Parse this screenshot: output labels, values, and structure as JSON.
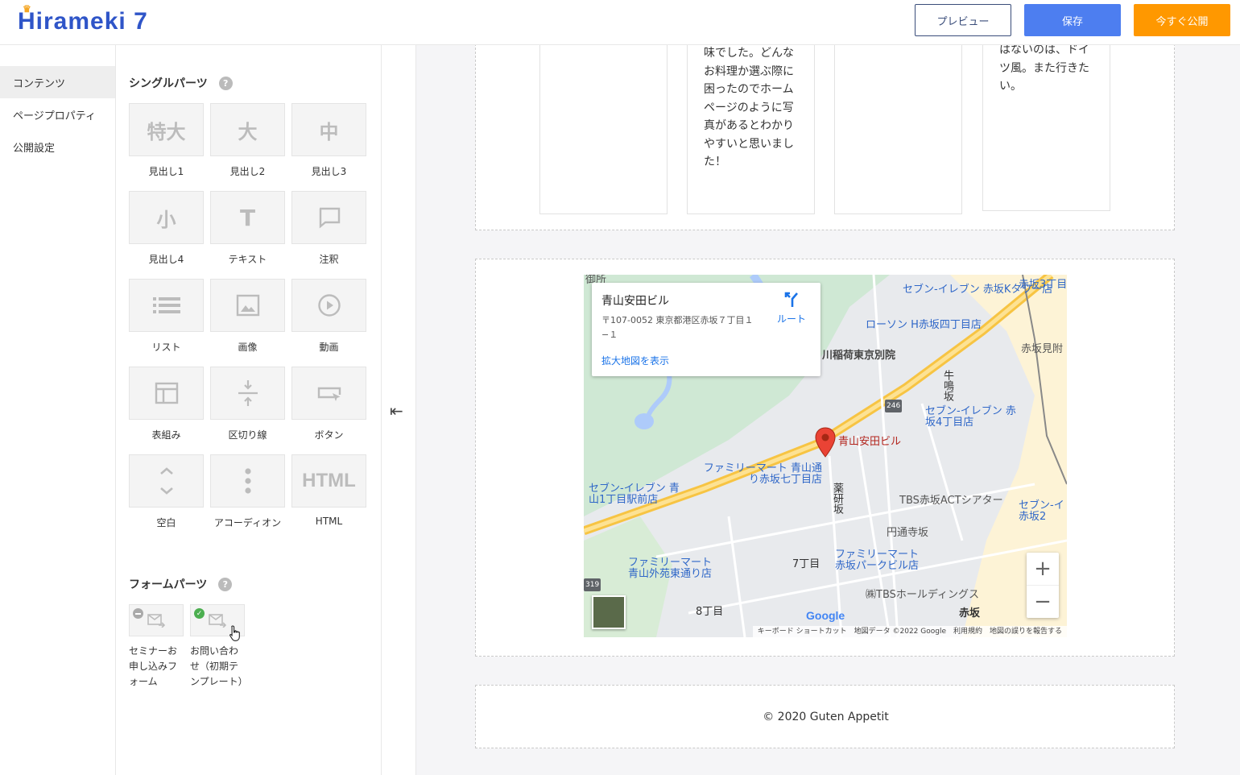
{
  "header": {
    "logo": "Hirameki 7",
    "preview": "プレビュー",
    "save": "保存",
    "publish": "今すぐ公開"
  },
  "nav": {
    "items": [
      "コンテンツ",
      "ページプロパティ",
      "公開設定"
    ]
  },
  "palette": {
    "single_title": "シングルパーツ",
    "help": "?",
    "tiles": [
      {
        "icon": "特大",
        "label": "見出し1"
      },
      {
        "icon": "大",
        "label": "見出し2"
      },
      {
        "icon": "中",
        "label": "見出し3"
      },
      {
        "icon": "小",
        "label": "見出し4"
      },
      {
        "icon": "T",
        "label": "テキスト"
      },
      {
        "icon": "",
        "label": "注釈"
      },
      {
        "icon": "",
        "label": "リスト"
      },
      {
        "icon": "",
        "label": "画像"
      },
      {
        "icon": "",
        "label": "動画"
      },
      {
        "icon": "",
        "label": "表組み"
      },
      {
        "icon": "",
        "label": "区切り線"
      },
      {
        "icon": "",
        "label": "ボタン"
      },
      {
        "icon": "",
        "label": "空白"
      },
      {
        "icon": "",
        "label": "アコーディオン"
      },
      {
        "icon": "HTML",
        "label": "HTML"
      }
    ],
    "form_title": "フォームパーツ",
    "forms": [
      {
        "label": "セミナーお申し込みフォーム"
      },
      {
        "label": "お問い合わせ（初期テンプレート）"
      }
    ]
  },
  "canvas": {
    "cards": [
      "",
      "味でした。どんなお料理か選ぶ際に困ったのでホームページのように写真があるとわかりやすいと思いました！",
      "",
      "はないのは、ドイツ風。また行きたい。"
    ],
    "map": {
      "place_name": "青山安田ビル",
      "address": "〒107-0052 東京都港区赤坂７丁目１−１",
      "route": "ルート",
      "larger_map": "拡大地図を表示",
      "zoom_in": "+",
      "zoom_out": "−",
      "attribution": "キーボード ショートカット　地図データ ©2022 Google　利用規約　地図の誤りを報告する",
      "google": "Google",
      "labels": [
        "セブン-イレブン 赤坂Kタワー店",
        "赤坂3丁目",
        "ローソン H赤坂四丁目店",
        "赤坂見附",
        "川稲荷東京別院",
        "セブン-イレブン 赤坂4丁目店",
        "青山安田ビル",
        "ファミリーマート 青山通り赤坂七丁目店",
        "セブン-イレブン 青山1丁目駅前店",
        "TBS赤坂ACTシアター",
        "セブン-イ 赤坂2",
        "円通寺坂",
        "ファミリーマート 青山外苑東通り店",
        "7丁目",
        "ファミリーマート 赤坂パークビル店",
        "8丁目",
        "㈱TBSホールディングス",
        "赤坂",
        "薬研坂",
        "牛鳴坂",
        "246",
        "319",
        "御所"
      ]
    },
    "footer": "© 2020 Guten Appetit"
  }
}
